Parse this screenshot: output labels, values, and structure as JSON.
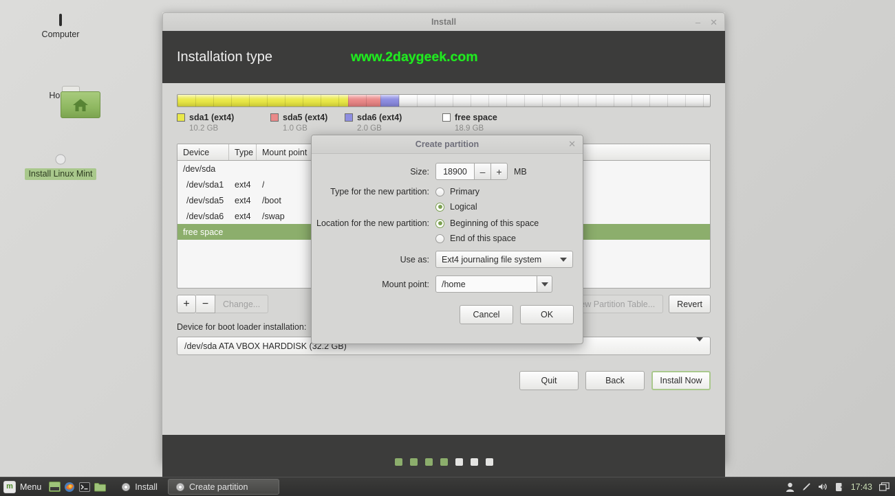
{
  "desktop": {
    "icons": [
      {
        "label": "Computer",
        "icon": "computer-monitor-icon",
        "selected": false
      },
      {
        "label": "Home",
        "icon": "home-folder-icon",
        "selected": false
      },
      {
        "label": "Install Linux Mint",
        "icon": "cd-disc-icon",
        "selected": true
      }
    ]
  },
  "window": {
    "title": "Install",
    "minimize_label": "–",
    "close_label": "✕",
    "header_title": "Installation type",
    "watermark": "www.2daygeek.com"
  },
  "partition_bar": {
    "segments": [
      {
        "name": "sda1 (ext4)",
        "size": "10.2 GB",
        "color": "#e9e84a",
        "percent": 32.1
      },
      {
        "name": "sda5 (ext4)",
        "size": "1.0 GB",
        "color": "#e98a8a",
        "percent": 6.0
      },
      {
        "name": "sda6 (ext4)",
        "size": "2.0 GB",
        "color": "#8e8ee0",
        "percent": 3.5
      },
      {
        "name": "free space",
        "size": "18.9 GB",
        "color": "#f2f2f2",
        "percent": 58.4
      }
    ]
  },
  "table": {
    "columns": [
      "Device",
      "Type",
      "Mount point"
    ],
    "rows": [
      {
        "device": "/dev/sda",
        "type": "",
        "mount": "",
        "selected": false,
        "indent": false
      },
      {
        "device": "/dev/sda1",
        "type": "ext4",
        "mount": "/",
        "selected": false,
        "indent": true
      },
      {
        "device": "/dev/sda5",
        "type": "ext4",
        "mount": "/boot",
        "selected": false,
        "indent": true
      },
      {
        "device": "/dev/sda6",
        "type": "ext4",
        "mount": "/swap",
        "selected": false,
        "indent": true
      },
      {
        "device": "free space",
        "type": "",
        "mount": "",
        "selected": true,
        "indent": false
      }
    ]
  },
  "table_tools": {
    "add_label": "+",
    "remove_label": "−",
    "change_label": "Change...",
    "new_partition_table_label": "New Partition Table...",
    "revert_label": "Revert"
  },
  "bootloader": {
    "label": "Device for boot loader installation:",
    "value": "/dev/sda   ATA VBOX HARDDISK (32.2 GB)"
  },
  "nav": {
    "quit_label": "Quit",
    "back_label": "Back",
    "install_label": "Install Now"
  },
  "progress_dots": {
    "total": 7,
    "filled": 4
  },
  "dialog": {
    "title": "Create partition",
    "close_label": "✕",
    "size": {
      "label": "Size:",
      "value": "18900",
      "minus_label": "–",
      "plus_label": "+",
      "unit": "MB"
    },
    "type": {
      "label": "Type for the new partition:",
      "options": [
        {
          "label": "Primary",
          "selected": false
        },
        {
          "label": "Logical",
          "selected": true
        }
      ]
    },
    "location": {
      "label": "Location for the new partition:",
      "options": [
        {
          "label": "Beginning of this space",
          "selected": true
        },
        {
          "label": "End of this space",
          "selected": false
        }
      ]
    },
    "use_as": {
      "label": "Use as:",
      "value": "Ext4 journaling file system"
    },
    "mount_point": {
      "label": "Mount point:",
      "value": "/home"
    },
    "cancel_label": "Cancel",
    "ok_label": "OK"
  },
  "taskbar": {
    "menu_label": "Menu",
    "launchers": [
      "terminal-window-icon",
      "firefox-icon",
      "terminal-icon",
      "file-manager-icon"
    ],
    "windows": [
      {
        "label": "Install",
        "active": false
      },
      {
        "label": "Create partition",
        "active": true
      }
    ],
    "tray": [
      "user-icon",
      "pen-icon",
      "volume-icon",
      "update-manager-icon"
    ],
    "clock": "17:43",
    "workspace_icon": "window-list-icon"
  },
  "colors": {
    "accent_green": "#8cae6c",
    "watermark_green": "#22e822",
    "header_dark": "#3c3c3b"
  }
}
